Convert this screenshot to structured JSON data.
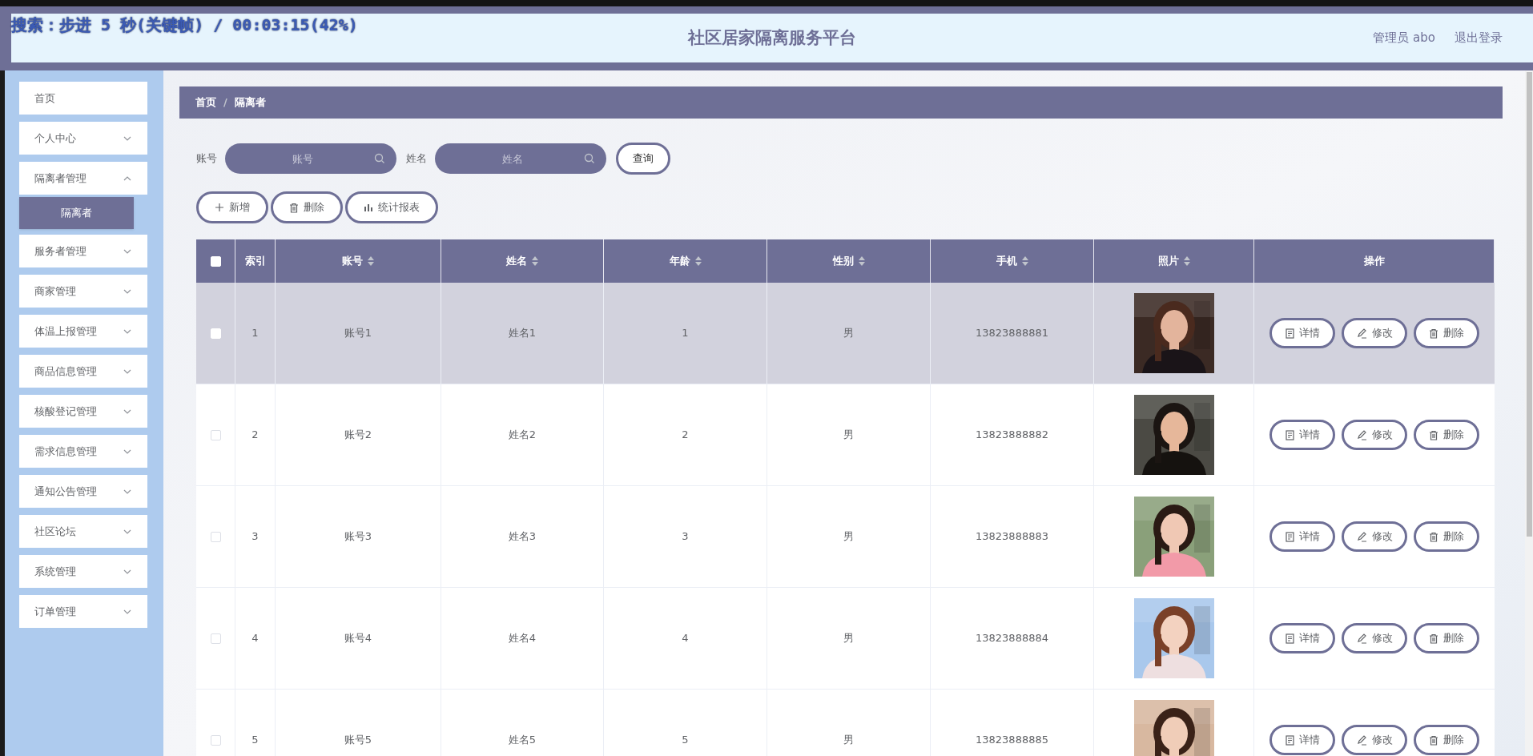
{
  "player_osd": "搜索：步进 5 秒(关键帧) / 00:03:15(42%)",
  "header": {
    "title": "社区居家隔离服务平台",
    "user": "管理员 abo",
    "logout": "退出登录"
  },
  "sidebar": {
    "items": [
      {
        "label": "首页",
        "has_children": false
      },
      {
        "label": "个人中心",
        "has_children": true,
        "expanded": false
      },
      {
        "label": "隔离者管理",
        "has_children": true,
        "expanded": true,
        "children": [
          {
            "label": "隔离者",
            "selected": true
          }
        ]
      },
      {
        "label": "服务者管理",
        "has_children": true,
        "expanded": false
      },
      {
        "label": "商家管理",
        "has_children": true,
        "expanded": false
      },
      {
        "label": "体温上报管理",
        "has_children": true,
        "expanded": false
      },
      {
        "label": "商品信息管理",
        "has_children": true,
        "expanded": false
      },
      {
        "label": "核酸登记管理",
        "has_children": true,
        "expanded": false
      },
      {
        "label": "需求信息管理",
        "has_children": true,
        "expanded": false
      },
      {
        "label": "通知公告管理",
        "has_children": true,
        "expanded": false
      },
      {
        "label": "社区论坛",
        "has_children": true,
        "expanded": false
      },
      {
        "label": "系统管理",
        "has_children": true,
        "expanded": false
      },
      {
        "label": "订单管理",
        "has_children": true,
        "expanded": false
      }
    ]
  },
  "breadcrumb": {
    "separator": "/",
    "items": [
      "首页",
      "隔离者"
    ]
  },
  "search": {
    "fields": [
      {
        "label": "账号",
        "placeholder": "账号"
      },
      {
        "label": "姓名",
        "placeholder": "姓名"
      }
    ],
    "button": "查询"
  },
  "toolbar": [
    {
      "kind": "add",
      "label": "新增"
    },
    {
      "kind": "delete",
      "label": "删除"
    },
    {
      "kind": "chart",
      "label": "统计报表"
    }
  ],
  "table": {
    "all_checked": false,
    "columns": [
      {
        "kind": "checkbox"
      },
      {
        "kind": "text",
        "label": "索引",
        "sortable": false
      },
      {
        "kind": "text",
        "label": "账号",
        "sortable": true
      },
      {
        "kind": "text",
        "label": "姓名",
        "sortable": true
      },
      {
        "kind": "text",
        "label": "年龄",
        "sortable": true
      },
      {
        "kind": "text",
        "label": "性别",
        "sortable": true
      },
      {
        "kind": "text",
        "label": "手机",
        "sortable": true
      },
      {
        "kind": "text",
        "label": "照片",
        "sortable": true
      },
      {
        "kind": "text",
        "label": "操作",
        "sortable": false
      }
    ],
    "rows": [
      {
        "selected": true,
        "checked": false,
        "index": "1",
        "account": "账号1",
        "name": "姓名1",
        "age": "1",
        "gender": "男",
        "phone": "13823888881",
        "actions": [
          {
            "kind": "detail",
            "label": "详情"
          },
          {
            "kind": "edit",
            "label": "修改"
          },
          {
            "kind": "delete",
            "label": "删除"
          }
        ]
      },
      {
        "selected": false,
        "checked": false,
        "index": "2",
        "account": "账号2",
        "name": "姓名2",
        "age": "2",
        "gender": "男",
        "phone": "13823888882",
        "actions": [
          {
            "kind": "detail",
            "label": "详情"
          },
          {
            "kind": "edit",
            "label": "修改"
          },
          {
            "kind": "delete",
            "label": "删除"
          }
        ]
      },
      {
        "selected": false,
        "checked": false,
        "index": "3",
        "account": "账号3",
        "name": "姓名3",
        "age": "3",
        "gender": "男",
        "phone": "13823888883",
        "actions": [
          {
            "kind": "detail",
            "label": "详情"
          },
          {
            "kind": "edit",
            "label": "修改"
          },
          {
            "kind": "delete",
            "label": "删除"
          }
        ]
      },
      {
        "selected": false,
        "checked": false,
        "index": "4",
        "account": "账号4",
        "name": "姓名4",
        "age": "4",
        "gender": "男",
        "phone": "13823888884",
        "actions": [
          {
            "kind": "detail",
            "label": "详情"
          },
          {
            "kind": "edit",
            "label": "修改"
          },
          {
            "kind": "delete",
            "label": "删除"
          }
        ]
      },
      {
        "selected": false,
        "checked": false,
        "index": "5",
        "account": "账号5",
        "name": "姓名5",
        "age": "5",
        "gender": "男",
        "phone": "13823888885",
        "actions": [
          {
            "kind": "detail",
            "label": "详情"
          },
          {
            "kind": "edit",
            "label": "修改"
          },
          {
            "kind": "delete",
            "label": "删除"
          }
        ]
      }
    ]
  }
}
